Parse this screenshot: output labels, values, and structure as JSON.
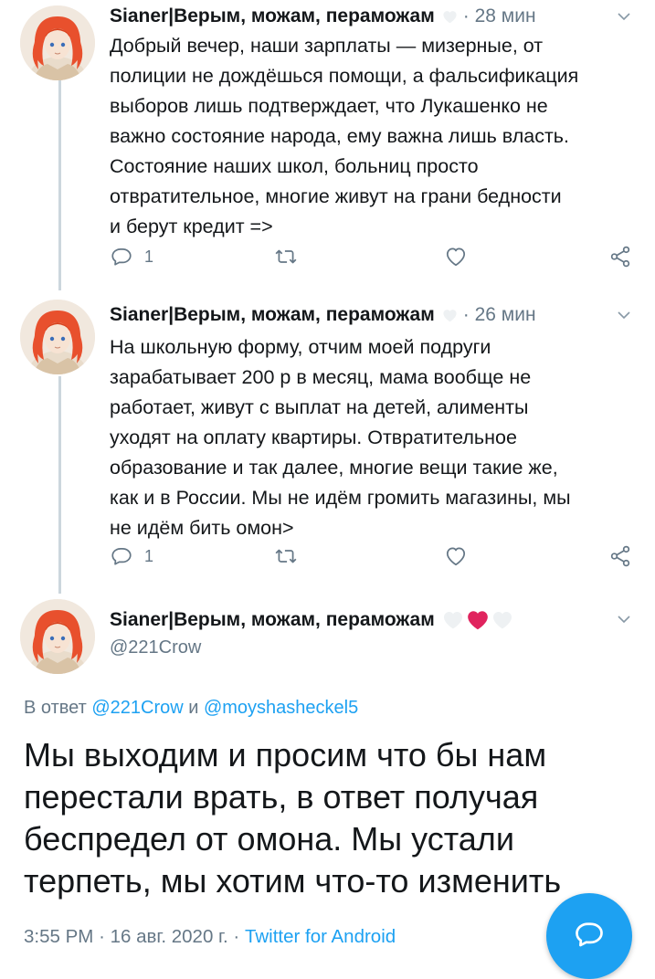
{
  "tweets": [
    {
      "author": "Sianer|Верым, можам, пераможам",
      "time": "· 28 мин",
      "text": "Добрый вечер, наши зарплаты — мизерные, от\nполиции не дождёшься помощи, а фальсификация\nвыборов лишь подтверждает, что Лукашенко не\nважно состояние народа, ему важна лишь власть.\nСостояние наших школ, больниц просто\nотвратительное, многие живут на грани бедности\nи берут кредит =>",
      "reply_count": "1"
    },
    {
      "author": "Sianer|Верым, можам, пераможам",
      "time": "· 26 мин",
      "text": "На школьную форму, отчим моей подруги\nзарабатывает 200 р в месяц, мама вообще не\nработает, живут с выплат на детей, алименты\nуходят на оплату квартиры. Отвратительное\nобразование и так далее, многие вещи такие же,\nкак и в России. Мы не идём громить магазины, мы\nне идём бить омон>",
      "reply_count": "1"
    }
  ],
  "focused": {
    "author": "Sianer|Верым, можам, пераможам",
    "handle": "@221Crow",
    "reply_prefix": "В ответ",
    "mention1": "@221Crow",
    "reply_and": "и",
    "mention2": "@moyshasheckel5",
    "text": "Мы выходим и просим что бы нам\nперестали врать, в ответ получая\nбеспредел от омона. Мы устали\nтерпеть, мы хотим что-то изменить",
    "time": "3:55 PM",
    "date": "· 16 авг. 2020 г. ·",
    "source": "Twitter for Android"
  },
  "icons": {
    "reply": "reply-icon",
    "retweet": "retweet-icon",
    "like": "heart-icon",
    "share": "share-icon",
    "more": "chevron-down-icon",
    "compose": "compose-reply-icon"
  },
  "colors": {
    "accent": "#1da1f2",
    "muted": "#657786",
    "heart_red": "#e0245e",
    "heart_white": "#eef1f3",
    "thread_line": "#ccd6dd"
  }
}
